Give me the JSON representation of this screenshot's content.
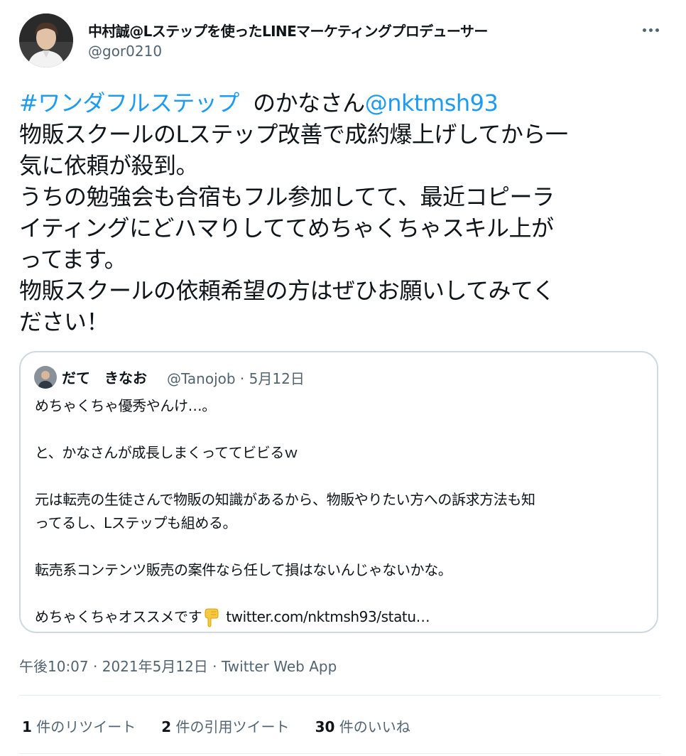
{
  "author": {
    "display_name": "中村誠@Lステップを使ったLINEマーケティングプロデューサー",
    "handle": "@gor0210"
  },
  "tweet": {
    "hashtag": "#ワンダフルステップ",
    "after_hashtag": "  のかなさん",
    "mention": "@nktmsh93",
    "lines": [
      "物販スクールのLステップ改善で成約爆上げしてから一",
      "気に依頼が殺到。",
      "うちの勉強会も合宿もフル参加してて、最近コピーラ",
      "イティングにどハマりしててめちゃくちゃスキル上が",
      "ってます。",
      "物販スクールの依頼希望の方はぜひお願いしてみてく",
      "ださい！"
    ]
  },
  "quote": {
    "name": "だて　きなお",
    "handle": "@Tanojob",
    "separator": "·",
    "date": "5月12日",
    "lines": [
      "めちゃくちゃ優秀やんけ…。",
      "",
      "と、かなさんが成長しまくっててビビるｗ",
      "",
      "元は転売の生徒さんで物販の知識があるから、物販やりたい方への訴求方法も知",
      "ってるし、Lステップも組める。",
      "",
      "転売系コンテンツ販売の案件なら任して損はないんじゃないかな。",
      ""
    ],
    "last_line_text": "めちゃくちゃオススメです",
    "emoji": "pointing-down-icon",
    "link": "twitter.com/nktmsh93/statu…"
  },
  "footer": {
    "time": "午後10:07",
    "sep1": " · ",
    "date": "2021年5月12日",
    "sep2": " · ",
    "source": "Twitter Web App"
  },
  "stats": [
    {
      "count": "1",
      "label": " 件のリツイート"
    },
    {
      "count": "2",
      "label": " 件の引用ツイート"
    },
    {
      "count": "30",
      "label": " 件のいいね"
    }
  ],
  "colors": {
    "link": "#1d9bf0",
    "secondary_text": "#536471",
    "border": "#cfd9de"
  }
}
